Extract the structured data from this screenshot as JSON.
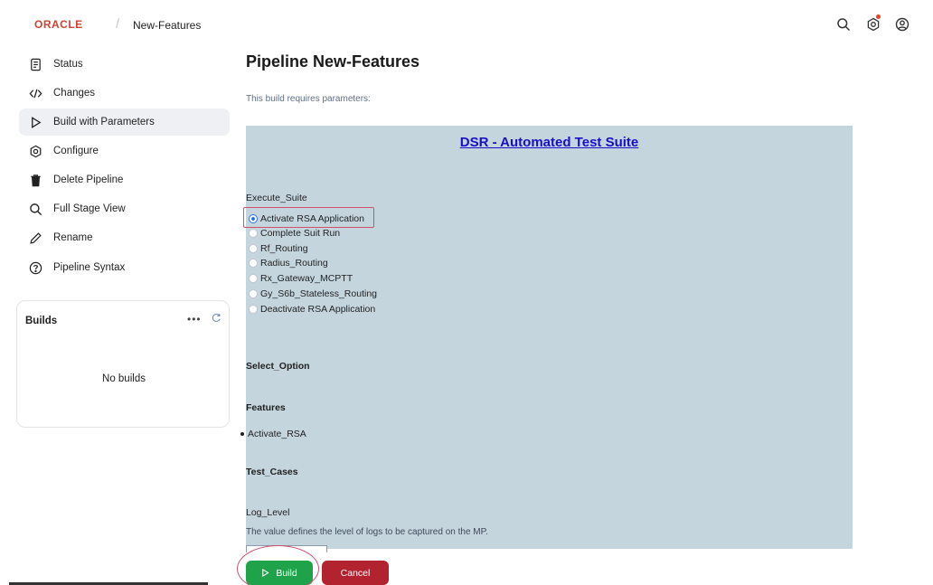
{
  "header": {
    "logo": "ORACLE",
    "breadcrumb": "New-Features",
    "icons": [
      "search-icon",
      "settings-icon",
      "user-icon"
    ],
    "notification_color": "#e0452a"
  },
  "sidebar": {
    "items": [
      {
        "label": "Status",
        "icon": "document-icon"
      },
      {
        "label": "Changes",
        "icon": "code-icon"
      },
      {
        "label": "Build with Parameters",
        "icon": "play-icon",
        "active": true
      },
      {
        "label": "Configure",
        "icon": "gear-icon"
      },
      {
        "label": "Delete Pipeline",
        "icon": "trash-icon"
      },
      {
        "label": "Full Stage View",
        "icon": "search-icon"
      },
      {
        "label": "Rename",
        "icon": "pencil-icon"
      },
      {
        "label": "Pipeline Syntax",
        "icon": "help-icon"
      }
    ],
    "builds": {
      "title": "Builds",
      "dots": "•••",
      "empty": "No builds"
    }
  },
  "main": {
    "title": "Pipeline New-Features",
    "requires_text": "This build requires parameters:",
    "suite_title": "DSR - Automated Test Suite",
    "execute_label": "Execute_Suite",
    "options": [
      {
        "label": "Activate RSA Application",
        "checked": true
      },
      {
        "label": "Complete Suit Run",
        "checked": false
      },
      {
        "label": "Rf_Routing",
        "checked": false
      },
      {
        "label": "Radius_Routing",
        "checked": false
      },
      {
        "label": "Rx_Gateway_MCPTT",
        "checked": false
      },
      {
        "label": "Gy_S6b_Stateless_Routing",
        "checked": false
      },
      {
        "label": "Deactivate RSA Application",
        "checked": false
      }
    ],
    "select_option_label": "Select_Option",
    "features_label": "Features",
    "feature_item": "Activate_RSA",
    "test_cases_label": "Test_Cases",
    "log_level_label": "Log_Level",
    "log_level_desc": "The value defines the level of logs to be captured on the MP.",
    "build_label": "Build",
    "cancel_label": "Cancel"
  },
  "colors": {
    "panel_bg": "#c5d5de",
    "link": "#1a0dcc",
    "build_btn": "#1ea34a",
    "cancel_btn": "#b3222f",
    "logo": "#c74634",
    "annotation": "#d0506e"
  }
}
